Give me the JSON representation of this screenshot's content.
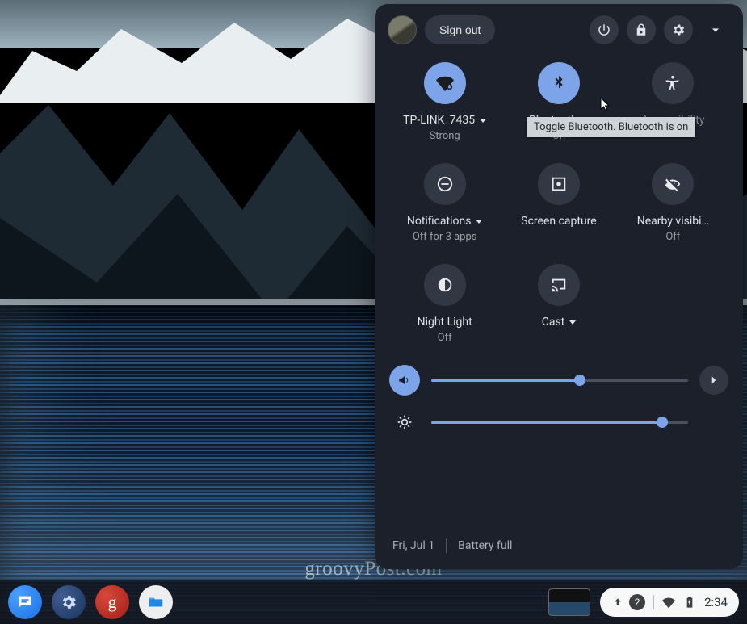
{
  "watermark": "groovyPost.com",
  "panel": {
    "sign_out": "Sign out",
    "tooltip": "Toggle Bluetooth. Bluetooth is on",
    "tiles": {
      "network": {
        "label": "TP-LINK_7435",
        "sub": "Strong",
        "caret": true,
        "on": true
      },
      "bluetooth": {
        "label": "Bluetooth",
        "sub": "On",
        "caret": true,
        "on": true
      },
      "accessibility": {
        "label": "Accessibility",
        "sub": "",
        "caret": false,
        "on": false
      },
      "notifications": {
        "label": "Notifications",
        "sub": "Off for 3 apps",
        "caret": true,
        "on": false
      },
      "screen_capture": {
        "label": "Screen capture",
        "sub": "",
        "caret": false,
        "on": false
      },
      "nearby": {
        "label": "Nearby visibi…",
        "sub": "Off",
        "caret": false,
        "on": false
      },
      "night_light": {
        "label": "Night Light",
        "sub": "Off",
        "caret": false,
        "on": false
      },
      "cast": {
        "label": "Cast",
        "sub": "",
        "caret": true,
        "on": false
      }
    },
    "volume_pct": 58,
    "brightness_pct": 90,
    "date": "Fri, Jul 1",
    "battery": "Battery full"
  },
  "shelf": {
    "notif_count": "2",
    "time": "2:34"
  }
}
